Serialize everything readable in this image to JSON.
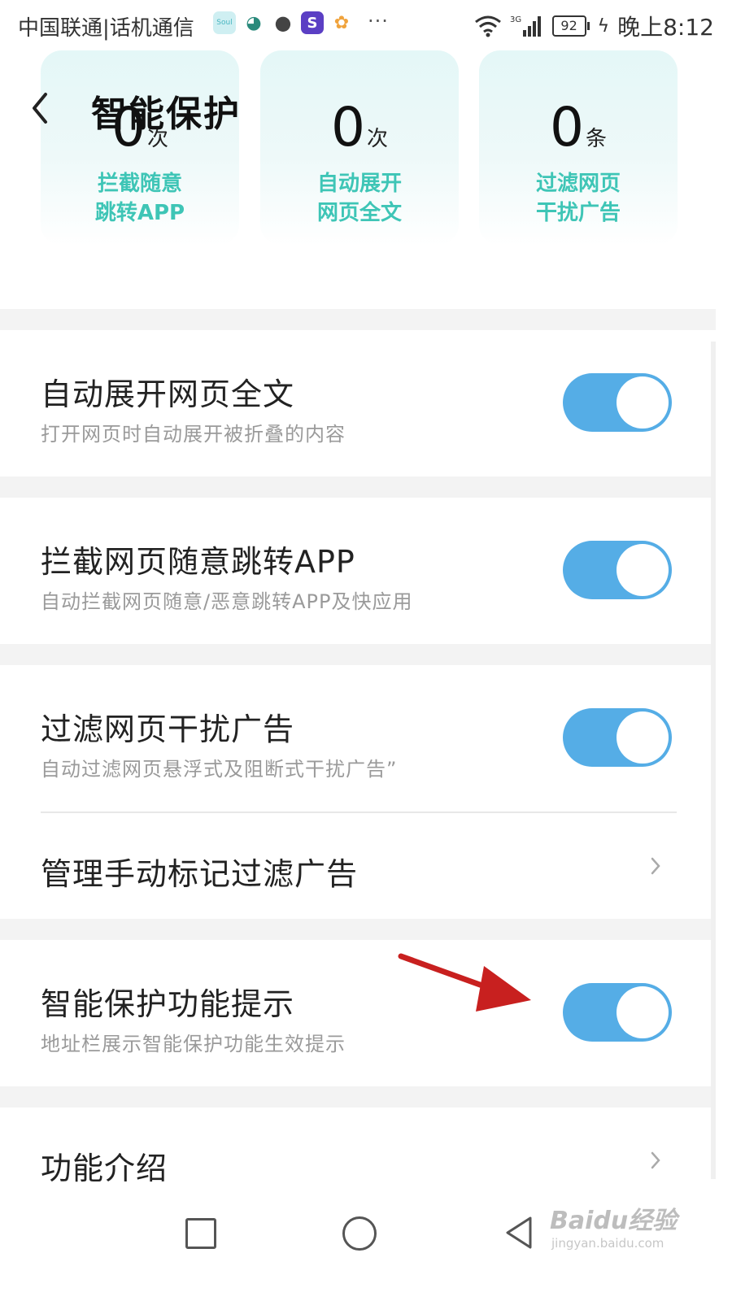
{
  "status_bar": {
    "carrier": "中国联通|话机通信",
    "app_soul_label": "Soul",
    "more": "···",
    "battery": "92",
    "time": "晚上8:12",
    "signal_type": "3G"
  },
  "header": {
    "title": "智能保护"
  },
  "stats": [
    {
      "value": "0",
      "unit": "次",
      "label": "拦截随意\n跳转APP"
    },
    {
      "value": "0",
      "unit": "次",
      "label": "自动展开\n网页全文"
    },
    {
      "value": "0",
      "unit": "条",
      "label": "过滤网页\n干扰广告"
    }
  ],
  "settings": {
    "auto_expand": {
      "title": "自动展开网页全文",
      "subtitle": "打开网页时自动展开被折叠的内容",
      "enabled": true
    },
    "block_jump": {
      "title": "拦截网页随意跳转APP",
      "subtitle": "自动拦截网页随意/恶意跳转APP及快应用",
      "enabled": true
    },
    "filter_ads": {
      "title": "过滤网页干扰广告",
      "subtitle": "自动过滤网页悬浮式及阻断式干扰广告”",
      "enabled": true
    },
    "manage_ads": {
      "title": "管理手动标记过滤广告"
    },
    "protect_tip": {
      "title": "智能保护功能提示",
      "subtitle": "地址栏展示智能保护功能生效提示",
      "enabled": true
    },
    "intro": {
      "title": "功能介绍"
    }
  },
  "colors": {
    "toggle_on": "#55ade6",
    "stat_label": "#3ec5b6",
    "annotation_arrow": "#c8201f"
  },
  "watermark": {
    "brand": "Baidu经验",
    "url": "jingyan.baidu.com"
  }
}
